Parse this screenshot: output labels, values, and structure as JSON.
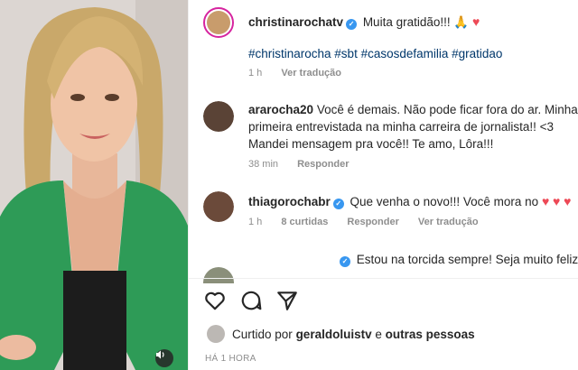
{
  "post": {
    "username": "christinarochatv",
    "caption": "Muita gratidão!!! 🙏",
    "hashtags": "#christinarocha #sbt #casosdefamilia #gratidao",
    "time": "1 h",
    "see_translation": "Ver tradução"
  },
  "comments": [
    {
      "username": "ararocha20",
      "line1": "Você é demais. Não pode ficar fora do ar. Minha",
      "line2": "primeira entrevistada na minha carreira de jornalista!! <3",
      "line3": "Mandei mensagem pra você!! Te amo, Lôra!!!",
      "time": "38 min",
      "reply": "Responder"
    },
    {
      "username": "thiagorochabr",
      "text": "Que venha o novo!!! Você mora no",
      "time": "1 h",
      "likes": "8 curtidas",
      "reply": "Responder",
      "see_translation": "Ver tradução"
    },
    {
      "text": "Estou na torcida sempre! Seja muito feliz"
    }
  ],
  "liked_by": {
    "prefix": "Curtido por",
    "user": "geraldoluistv",
    "middle": "e",
    "others": "outras pessoas"
  },
  "timestamp": "HÁ 1 HORA",
  "colors": {
    "verified": "#3897f0",
    "heart": "#ed4956",
    "hashtag": "#00376b",
    "jacket": "#2e9b57"
  },
  "icons": [
    "heart-icon",
    "comment-icon",
    "share-icon",
    "sound-icon",
    "verified-icon"
  ]
}
